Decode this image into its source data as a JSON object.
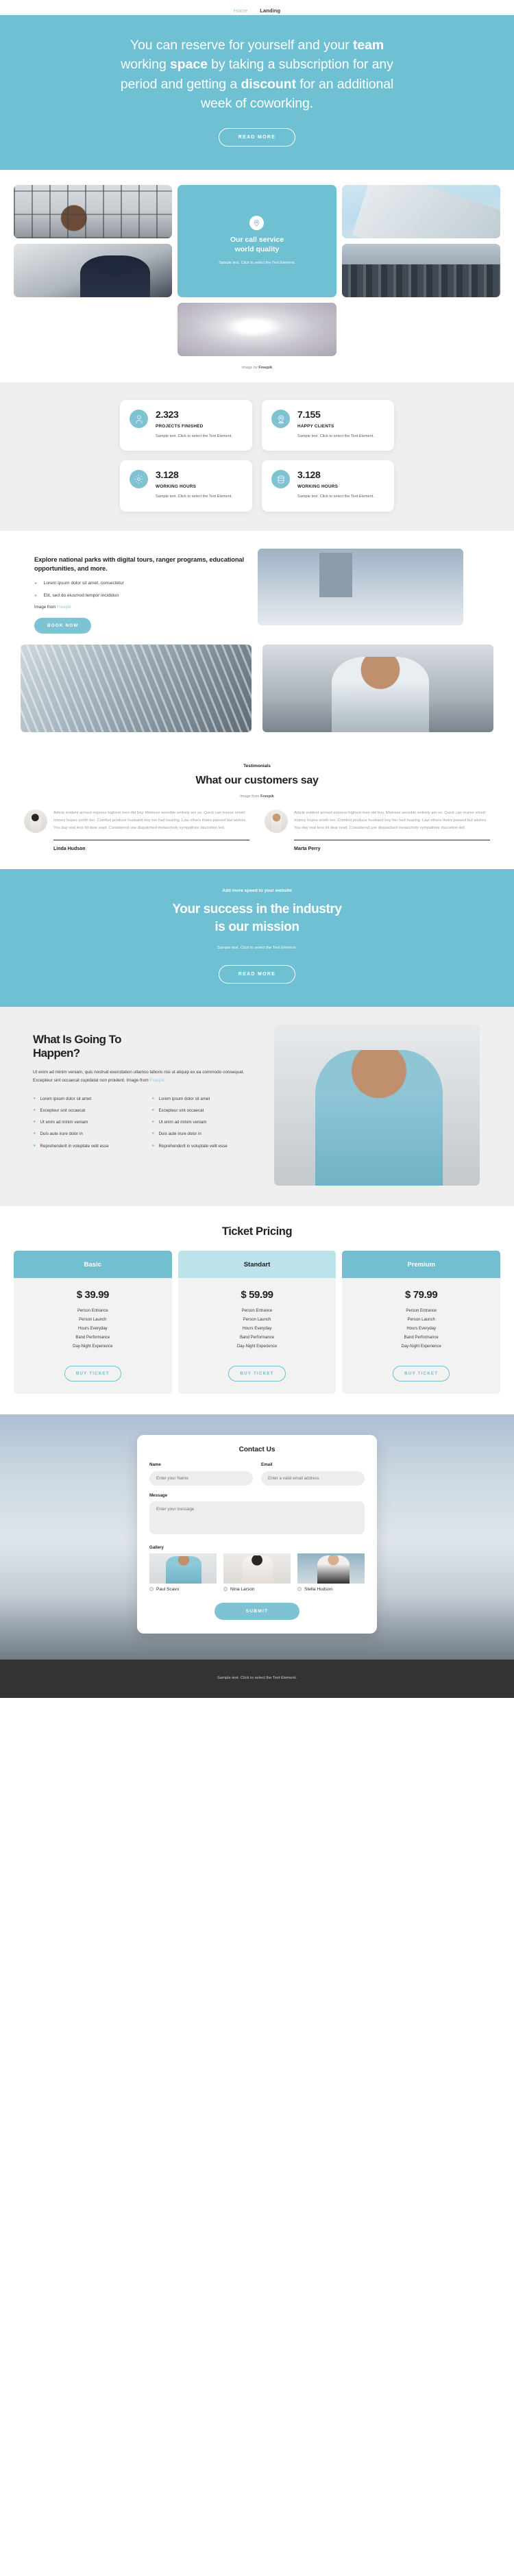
{
  "nav": {
    "items": [
      {
        "label": "Home",
        "active": false
      },
      {
        "label": "Landing",
        "active": true
      }
    ]
  },
  "hero": {
    "line1_a": "You can reserve for yourself and your ",
    "line1_b": "team",
    "line2_a": "working ",
    "line2_b": "space",
    "line2_c": " by taking a subscription for any",
    "line3_a": "period and getting a ",
    "line3_b": "discount",
    "line3_c": " for an additional",
    "line4": "week of coworking.",
    "cta_label": "READ MORE",
    "bg_color": "#6fc0d2"
  },
  "gallery": {
    "card": {
      "icon": "location-pin-icon",
      "title_line1": "Our call service",
      "title_line2": "world quality",
      "text": "Sample text. Click to select the Text Element."
    },
    "tiles": [
      {
        "name": "smiling-woman-photo"
      },
      {
        "name": "sky-tower-photo"
      },
      {
        "name": "businessmen-meeting-photo"
      },
      {
        "name": "spiral-staircase-photo"
      },
      {
        "name": "city-skyscrapers-photo"
      }
    ],
    "credit_prefix": "Image by ",
    "credit_source": "Freepik"
  },
  "stats": {
    "items": [
      {
        "icon": "person-icon",
        "number": "2.323",
        "label": "PROJECTS FINISHED",
        "desc": "Sample text. Click to select the Text Element."
      },
      {
        "icon": "location-pin-icon",
        "number": "7.155",
        "label": "HAPPY CLIENTS",
        "desc": "Sample text. Click to select the Text Element."
      },
      {
        "icon": "gear-icon",
        "number": "3.128",
        "label": "WORKING HOURS",
        "desc": "Sample text. Click to select the Text Element."
      },
      {
        "icon": "database-icon",
        "number": "3.128",
        "label": "WORKING HOURS",
        "desc": "Sample text. Click to select the Text Element."
      }
    ],
    "bg_color": "#efefef"
  },
  "explore": {
    "heading": "Explore national parks with digital tours, ranger programs, educational opportunities, and more.",
    "bullets": [
      "Lorem ipsum dolor sit amet, consectetur",
      "Elit, sed do eiusmod tempor incididun"
    ],
    "credit_prefix": "Image from ",
    "credit_source": "Freepik",
    "cta_label": "BOOK NOW",
    "images": [
      {
        "name": "foggy-city-photo"
      },
      {
        "name": "glass-building-photo"
      },
      {
        "name": "man-with-glasses-photo"
      }
    ]
  },
  "testimonials": {
    "kicker": "Testimonials",
    "title": "What our customers say",
    "credit_prefix": "Image from ",
    "credit_source": "Freepik",
    "items": [
      {
        "avatar": "linda-hudson-avatar",
        "quote": "Article evident arrived express highest men did boy. Mistress sensible entirely am so. Quick can manor smart money hopes worth too. Comfort produce husband boy her had hearing. Law others theirs passed but wishes. You day real less till dear read. Considered use dispatched melancholy sympathize discretion led.",
        "name": "Linda Hudson"
      },
      {
        "avatar": "marta-perry-avatar",
        "quote": "Article evident arrived express highest men did boy. Mistress sensible entirely am so. Quick can manor smart money hopes worth too. Comfort produce husband boy her had hearing. Law others theirs passed but wishes. You day real less till dear read. Considered use dispatched melancholy sympathize discretion led.",
        "name": "Marta Perry"
      }
    ]
  },
  "mission": {
    "kicker": "Add more speed to your website",
    "title_line1": "Your success in the industry",
    "title_line2": "is our mission",
    "subtitle": "Sample text. Click to select the Text Element.",
    "cta_label": "READ MORE",
    "bg_color": "#6fc0d2"
  },
  "happen": {
    "title_line1": "What Is Going To",
    "title_line2": "Happen?",
    "paragraph_prefix": "Ut enim ad minim veniam, quis nostrud exercitation ullamco laboris nisi ut aliquip ex ea commodo consequat. Excepteur sint occaecat cupidatat non proident. Image from ",
    "paragraph_link": "Freepik",
    "features_left": [
      "Lorem ipsum dolor sit amet",
      "Excepteur sint occaecat",
      "Ut enim ad minim veniam",
      "Duis aute irure dolor in",
      "Reprehenderit in voluptate velit esse"
    ],
    "features_right": [
      "Lorem ipsum dolor sit amet",
      "Excepteur sint occaecat",
      "Ut enim ad minim veniam",
      "Duis aute irure dolor in",
      "Reprehenderit in voluptate velit esse"
    ],
    "image": "bearded-man-photo"
  },
  "pricing": {
    "title": "Ticket Pricing",
    "plans": [
      {
        "name": "Basic",
        "price": "$ 39.99",
        "head_style": "accent",
        "features": [
          "Person Entrance",
          "Person Launch",
          "Hours Everyday",
          "Band Performance",
          "Day-Night Experience"
        ],
        "cta_label": "BUY TICKET"
      },
      {
        "name": "Standart",
        "price": "$ 59.99",
        "head_style": "light",
        "features": [
          "Person Entrance",
          "Person Launch",
          "Hours Everyday",
          "Band Performance",
          "Day-Night Experience"
        ],
        "cta_label": "BUY TICKET"
      },
      {
        "name": "Premium",
        "price": "$ 79.99",
        "head_style": "accent",
        "features": [
          "Person Entrance",
          "Person Launch",
          "Hours Everyday",
          "Band Performance",
          "Day-Night Experience"
        ],
        "cta_label": "BUY TICKET"
      }
    ],
    "accent_color": "#71bfd1",
    "light_color": "#bde3ea"
  },
  "contact": {
    "title": "Contact Us",
    "name_label": "Name",
    "name_placeholder": "Enter your Name",
    "name_value": "",
    "email_label": "Email",
    "email_placeholder": "Enter a valid email address",
    "email_value": "",
    "message_label": "Message",
    "message_placeholder": "Enter your message",
    "message_value": "",
    "gallery_label": "Gallery",
    "gallery": [
      {
        "image": "paul-scavo-photo",
        "name": "Paul Scavo"
      },
      {
        "image": "nina-larson-photo",
        "name": "Nina Larson"
      },
      {
        "image": "stella-hudson-photo",
        "name": "Stella Hudson"
      }
    ],
    "submit_label": "SUBMIT"
  },
  "footer": {
    "text": "Sample text. Click to select the Text Element.",
    "bg_color": "#333333"
  }
}
